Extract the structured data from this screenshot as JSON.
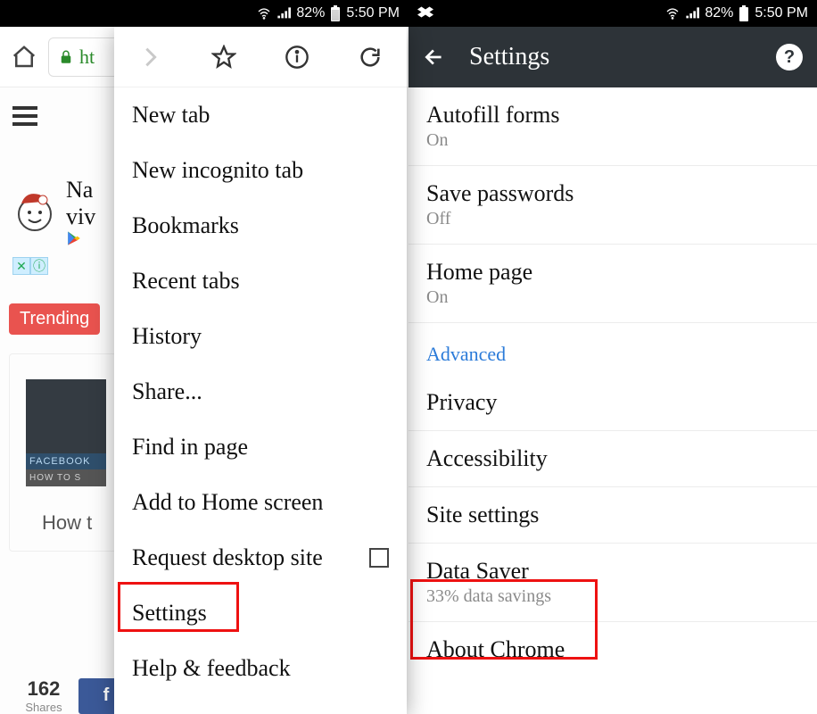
{
  "statusbar": {
    "battery": "82%",
    "time": "5:50 PM"
  },
  "left": {
    "url_prefix": "ht",
    "hamburger_name": "menu-icon",
    "ad": {
      "line1": "Na",
      "line2": "viv"
    },
    "trending": "Trending",
    "card": {
      "thumb_row1": "FACEBOOK",
      "thumb_row2": "HOW TO S",
      "caption": "How t"
    },
    "shares": {
      "count": "162",
      "label": "Shares"
    },
    "menu": {
      "new_tab": "New tab",
      "new_incognito": "New incognito tab",
      "bookmarks": "Bookmarks",
      "recent_tabs": "Recent tabs",
      "history": "History",
      "share": "Share...",
      "find": "Find in page",
      "add_home": "Add to Home screen",
      "request_desktop": "Request desktop site",
      "settings": "Settings",
      "help": "Help & feedback"
    }
  },
  "right": {
    "title": "Settings",
    "items": {
      "autofill": {
        "t": "Autofill forms",
        "s": "On"
      },
      "save_pw": {
        "t": "Save passwords",
        "s": "Off"
      },
      "home": {
        "t": "Home page",
        "s": "On"
      },
      "advanced": "Advanced",
      "privacy": "Privacy",
      "accessibility": "Accessibility",
      "site": "Site settings",
      "data_saver": {
        "t": "Data Saver",
        "s": "33% data savings"
      },
      "about": "About Chrome"
    }
  }
}
